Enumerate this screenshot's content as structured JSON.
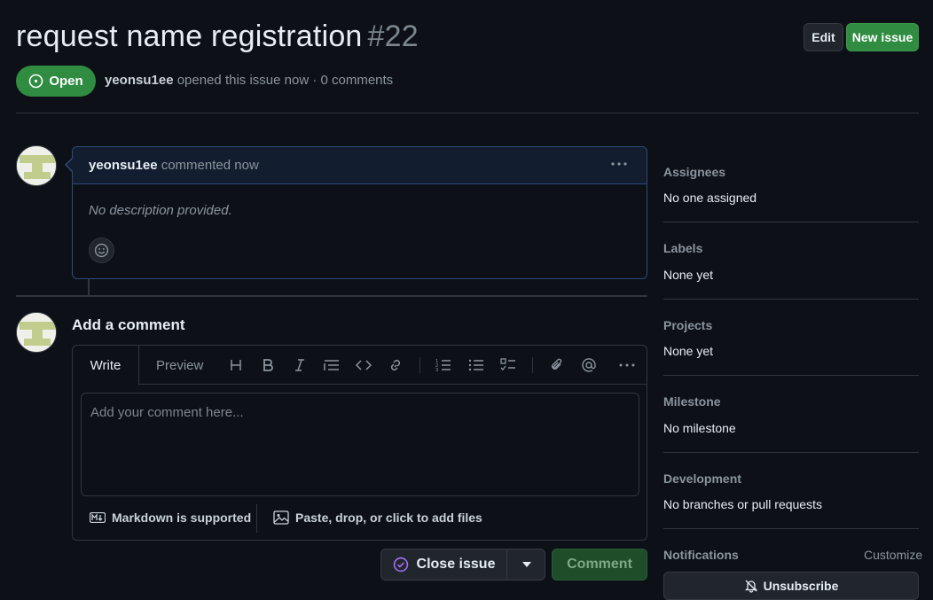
{
  "issue": {
    "title": "request name registration",
    "number": "#22",
    "state": "Open",
    "author": "yeonsu1ee",
    "meta_text": "opened this issue now · 0 comments"
  },
  "header": {
    "edit_label": "Edit",
    "new_issue_label": "New issue"
  },
  "comment": {
    "author": "yeonsu1ee",
    "time_text": "commented now",
    "body": "No description provided.",
    "menu_icon": "kebab-horizontal-icon"
  },
  "composer": {
    "title": "Add a comment",
    "tab_write": "Write",
    "tab_preview": "Preview",
    "placeholder": "Add your comment here...",
    "markdown_note": "Markdown is supported",
    "attach_note": "Paste, drop, or click to add files",
    "toolbar_icons": [
      "heading-icon",
      "bold-icon",
      "italic-icon",
      "quote-icon",
      "code-icon",
      "link-icon",
      "ordered-list-icon",
      "unordered-list-icon",
      "task-list-icon",
      "attachment-icon",
      "mention-icon",
      "more-icon"
    ],
    "close_issue_label": "Close issue",
    "comment_label": "Comment"
  },
  "sidebar": {
    "sections": [
      {
        "heading": "Assignees",
        "value": "No one assigned"
      },
      {
        "heading": "Labels",
        "value": "None yet"
      },
      {
        "heading": "Projects",
        "value": "None yet"
      },
      {
        "heading": "Milestone",
        "value": "No milestone"
      },
      {
        "heading": "Development",
        "value": "No branches or pull requests"
      }
    ],
    "notifications": {
      "heading": "Notifications",
      "customize": "Customize",
      "unsubscribe_label": "Unsubscribe"
    }
  },
  "colors": {
    "background": "#0d1117",
    "open_green": "#2f8c41",
    "comment_header": "#121d2f",
    "comment_border": "#2f4a7a"
  }
}
